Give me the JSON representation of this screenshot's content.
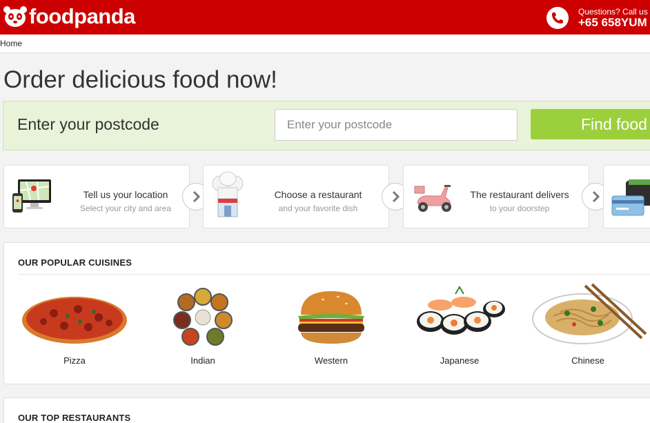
{
  "header": {
    "logo_text": "foodpanda",
    "phone_question": "Questions? Call us",
    "phone_number": "+65 658YUM",
    "brand_color": "#cc0000"
  },
  "breadcrumb": {
    "home": "Home"
  },
  "hero": {
    "title": "Order delicious food now!"
  },
  "postcode": {
    "label": "Enter your postcode",
    "placeholder": "Enter your postcode",
    "value": "",
    "button_label": "Find food",
    "panel_color": "#e9f3d9",
    "button_color": "#9ccf3c"
  },
  "steps": [
    {
      "title": "Tell us your location",
      "subtitle": "Select your city and area",
      "icon": "devices-map-icon"
    },
    {
      "title": "Choose a restaurant",
      "subtitle": "and your favorite dish",
      "icon": "chef-hat-icon"
    },
    {
      "title": "The restaurant delivers",
      "subtitle": "to your doorstep",
      "icon": "scooter-icon"
    },
    {
      "title": "",
      "subtitle": "",
      "icon": "wallet-card-icon"
    }
  ],
  "cuisines": {
    "heading": "OUR POPULAR CUISINES",
    "items": [
      {
        "name": "Pizza",
        "icon": "pizza-icon"
      },
      {
        "name": "Indian",
        "icon": "indian-thali-icon"
      },
      {
        "name": "Western",
        "icon": "burger-icon"
      },
      {
        "name": "Japanese",
        "icon": "sushi-icon"
      },
      {
        "name": "Chinese",
        "icon": "noodles-icon"
      }
    ]
  },
  "restaurants": {
    "heading": "OUR TOP RESTAURANTS"
  }
}
